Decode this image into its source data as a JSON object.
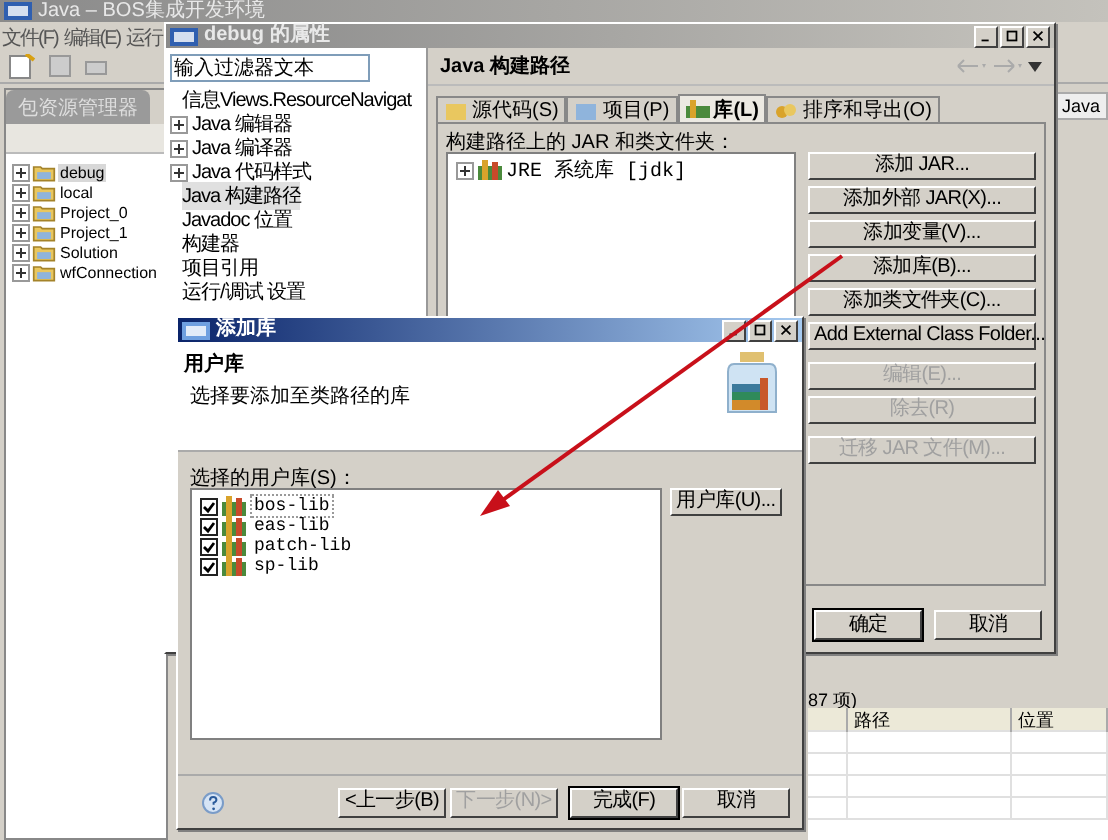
{
  "main_window": {
    "title": "Java – BOS集成开发环境",
    "menu": [
      "文件(F)",
      "编辑(E)",
      "运行"
    ],
    "explorer_tab": "包资源管理器",
    "projects": [
      {
        "label": "debug",
        "selected": true
      },
      {
        "label": "local",
        "selected": false
      },
      {
        "label": "Project_0",
        "selected": false
      },
      {
        "label": "Project_1",
        "selected": false
      },
      {
        "label": "Solution",
        "selected": false
      },
      {
        "label": "wfConnection",
        "selected": false
      }
    ],
    "perspective": "Java",
    "item_count": "87 项)",
    "table": {
      "columns": [
        "路径",
        "位置"
      ]
    }
  },
  "properties_dialog": {
    "title": "debug 的属性",
    "filter": {
      "placeholder": "输入过滤器文本"
    },
    "pages": [
      {
        "label": "信息Views.ResourceNavigat",
        "kind": "page",
        "selected": false
      },
      {
        "label": "Java 编辑器",
        "kind": "group",
        "selected": false
      },
      {
        "label": "Java 编译器",
        "kind": "group",
        "selected": false
      },
      {
        "label": "Java 代码样式",
        "kind": "group",
        "selected": false
      },
      {
        "label": "Java 构建路径",
        "kind": "page",
        "selected": true
      },
      {
        "label": "Javadoc 位置",
        "kind": "page",
        "selected": false
      },
      {
        "label": "构建器",
        "kind": "page",
        "selected": false
      },
      {
        "label": "项目引用",
        "kind": "page",
        "selected": false
      },
      {
        "label": "运行/调试 设置",
        "kind": "page",
        "selected": false
      }
    ],
    "page_title": "Java 构建路径",
    "tabs": [
      {
        "label": "源代码(S)",
        "selected": false
      },
      {
        "label": "项目(P)",
        "selected": false
      },
      {
        "label": "库(L)",
        "selected": true
      },
      {
        "label": "排序和导出(O)",
        "selected": false
      }
    ],
    "list_label": "构建路径上的 JAR 和类文件夹：",
    "entries": [
      "JRE 系统库 [jdk]"
    ],
    "button_groups": [
      [
        {
          "label": "添加 JAR...",
          "disabled": false
        },
        {
          "label": "添加外部 JAR(X)...",
          "disabled": false
        },
        {
          "label": "添加变量(V)...",
          "disabled": false
        },
        {
          "label": "添加库(B)...",
          "disabled": false
        },
        {
          "label": "添加类文件夹(C)...",
          "disabled": false
        },
        {
          "label": "Add External Class Folder...",
          "disabled": false
        }
      ],
      [
        {
          "label": "编辑(E)...",
          "disabled": true
        },
        {
          "label": "除去(R)",
          "disabled": true
        }
      ],
      [
        {
          "label": "迁移 JAR 文件(M)...",
          "disabled": true
        }
      ]
    ],
    "footer_buttons": [
      "确定",
      "取消"
    ]
  },
  "add_library_dialog": {
    "title": "添加库",
    "heading": "用户库",
    "description": "选择要添加至类路径的库",
    "list_label": "选择的用户库(S)：",
    "libraries": [
      {
        "label": "bos-lib",
        "checked": true,
        "selected": true
      },
      {
        "label": "eas-lib",
        "checked": true,
        "selected": false
      },
      {
        "label": "patch-lib",
        "checked": true,
        "selected": false
      },
      {
        "label": "sp-lib",
        "checked": true,
        "selected": false
      }
    ],
    "side_button": "用户库(U)...",
    "footer_buttons": [
      {
        "label": "<上一步(B)",
        "disabled": false
      },
      {
        "label": "下一步(N)>",
        "disabled": true
      },
      {
        "label": "完成(F)",
        "disabled": false
      },
      {
        "label": "取消",
        "disabled": false
      }
    ]
  }
}
